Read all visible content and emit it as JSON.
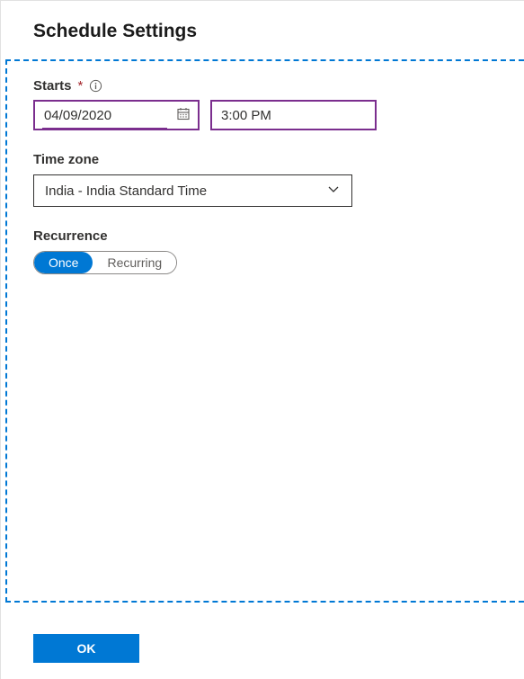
{
  "header": {
    "title": "Schedule Settings"
  },
  "starts": {
    "label": "Starts",
    "required_marker": "*",
    "date_value": "04/09/2020",
    "time_value": "3:00 PM"
  },
  "timezone": {
    "label": "Time zone",
    "value": "India - India Standard Time"
  },
  "recurrence": {
    "label": "Recurrence",
    "once_label": "Once",
    "recurring_label": "Recurring",
    "selected": "once"
  },
  "footer": {
    "ok_label": "OK"
  }
}
